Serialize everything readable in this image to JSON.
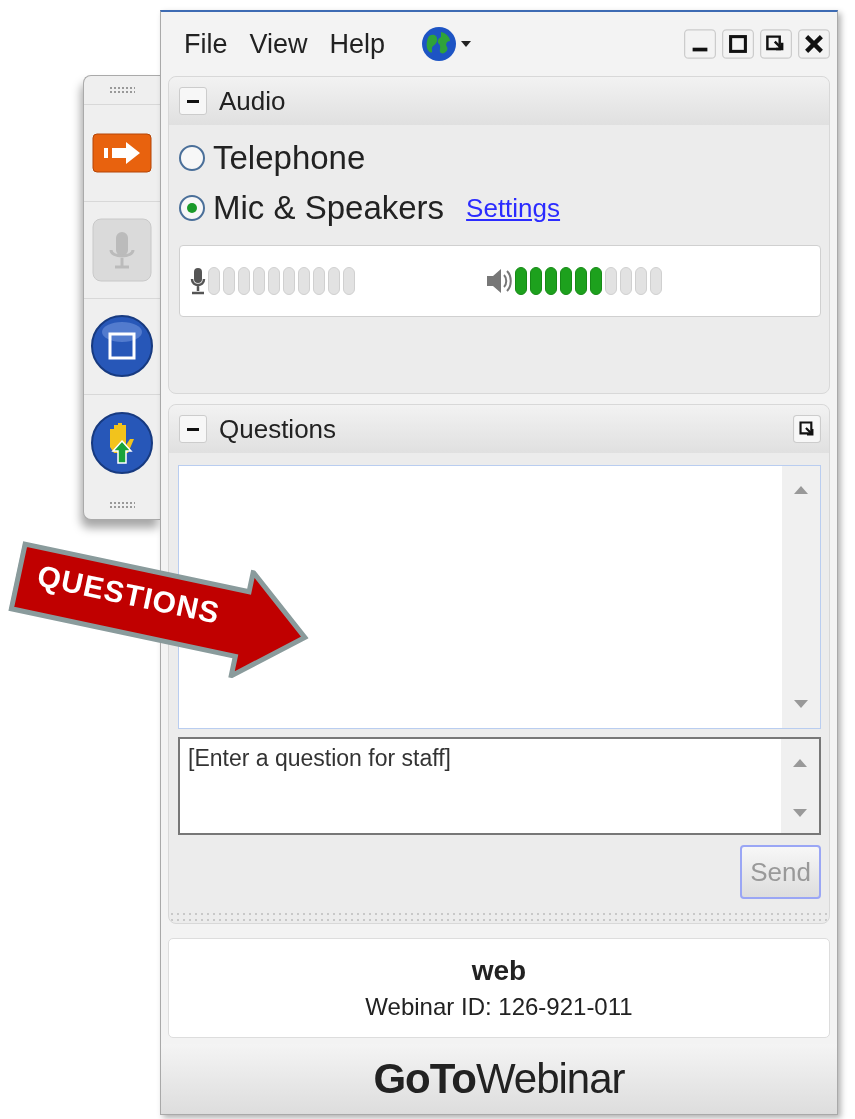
{
  "toolbar": [
    {
      "kind": "show-panel",
      "disabled": false
    },
    {
      "kind": "microphone",
      "disabled": true
    },
    {
      "kind": "screen",
      "disabled": false
    },
    {
      "kind": "raise-hand",
      "disabled": false
    }
  ],
  "menu": [
    {
      "label": "File"
    },
    {
      "label": "View"
    },
    {
      "label": "Help"
    }
  ],
  "audio": {
    "title": "Audio",
    "expanded": true,
    "options": [
      {
        "label": "Telephone",
        "selected": false
      },
      {
        "label": "Mic & Speakers",
        "selected": true
      }
    ],
    "settings_link": "Settings",
    "meters": [
      {
        "kind": "microphone"
      },
      {
        "kind": "speaker",
        "level": 0.6
      }
    ]
  },
  "questions": {
    "title": "Questions",
    "expanded": true,
    "input": {
      "placeholder": "[Enter a question for staff]"
    },
    "send_button": {
      "label": "Send",
      "disabled": true
    }
  },
  "session": {
    "name": "web",
    "id_line": "Webinar ID: 126-921-011"
  },
  "brand": "**GoTo**Webinar",
  "callout": {
    "label": "QUESTIONS"
  }
}
